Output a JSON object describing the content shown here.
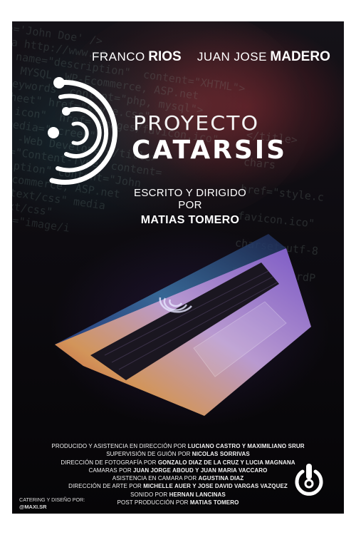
{
  "cast": [
    {
      "first": "FRANCO",
      "last": "RIOS"
    },
    {
      "first": "JUAN JOSE",
      "last": "MADERO"
    }
  ],
  "title": {
    "line1": "PROYECTO",
    "line2": "CATARSIS"
  },
  "written": {
    "label": "ESCRITO Y DIRIGIDO POR",
    "name": "MATIAS TOMERO"
  },
  "background_code": [
    "e='John Doe' />",
    "ta http://www.w3",
    "a name=\"description\"  content=\"XHTML\">",
    "s, MYSQL, WP-Ecommerce, ASP.net",
    "\"keywords\" content=\"php, mysql\">",
    "lsheet\" href=\"style.css\"",
    "ut icon\"  href=\"images/favicon.ico\"",
    "  media=\"screen\"",
    "Doe -Web Developer</title>",
    "uiv=\"Content-Type\" content=",
    "scription\" content=\"John",
    "WP-Ecommerce, ASP.net",
    "pe=\"text/css\" media",
    "=\"text/css\"",
    "types=\"image/i"
  ],
  "background_code_right": [
    "</title>",
    "chars",
    "href=\"style.c",
    "favicon.ico\"",
    "charset=utf-8",
    "pun and WordP"
  ],
  "credits": [
    {
      "pre": "PRODUCIDO Y ASISTENCIA EN DIRECCIÓN POR",
      "names": "LUCIANO CASTRO Y MAXIMILIANO SRUR"
    },
    {
      "pre": "SUPERVISIÓN DE GUIÓN POR",
      "names": "NICOLAS SORRIVAS"
    },
    {
      "pre": "DIRECCIÓN DE FOTOGRAFÍA POR",
      "names": "GONZALO DIAZ DE LA CRUZ Y LUCIA MAGNANA"
    },
    {
      "pre": "CAMARAS POR",
      "names": "JUAN JORGE ABOUD Y JUAN MARIA VACCARO"
    },
    {
      "pre": "ASISTENCIA EN CAMARA POR",
      "names": "AGUSTINA DIAZ"
    },
    {
      "pre": "DIRECCIÓN DE ARTE POR",
      "names": "MICHELLE AUER Y JOSE DAVID VARGAS VAZQUEZ"
    },
    {
      "pre": "SONIDO POR",
      "names": "HERNAN LANCINAS"
    },
    {
      "pre": "POST PRODUCCIÓN POR",
      "names": "MATIAS TOMERO"
    }
  ],
  "catering": {
    "label": "CATERING Y DISEÑO POR:",
    "handle": "@MAXI.SR"
  },
  "colors": {
    "poster_bg": "#0b0a10",
    "text": "#ffffff",
    "accent_red": "#b33a3f",
    "screen_purple": "#8a6fd1"
  }
}
